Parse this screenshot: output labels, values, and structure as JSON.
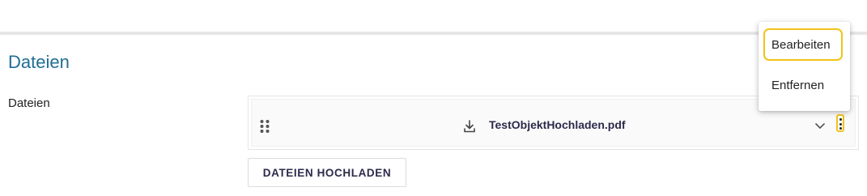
{
  "section": {
    "title": "Dateien"
  },
  "field": {
    "label": "Dateien"
  },
  "files": [
    {
      "name": "TestObjektHochladen.pdf"
    }
  ],
  "upload_button": {
    "label": "DATEIEN HOCHLADEN"
  },
  "context_menu": {
    "items": [
      {
        "label": "Bearbeiten",
        "focused": true
      },
      {
        "label": "Entfernen",
        "focused": false
      }
    ]
  },
  "icons": {
    "drag": "drag-handle-icon",
    "download": "download-icon",
    "expand": "chevron-down-icon",
    "more": "more-vertical-icon"
  },
  "colors": {
    "section_title": "#1f6e96",
    "focus_ring": "#f0c419",
    "file_name": "#2c2a4a"
  }
}
